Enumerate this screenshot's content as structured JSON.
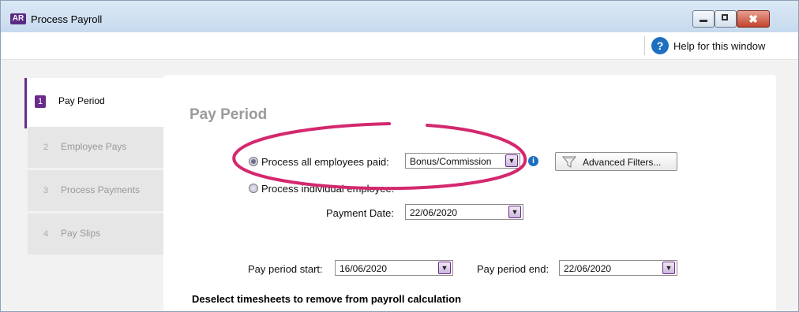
{
  "window": {
    "app_badge": "AR",
    "title": "Process Payroll",
    "controls": {
      "minimize_icon": "minimize-icon",
      "maximize_icon": "maximize-icon",
      "close_glyph": "✖"
    }
  },
  "toolbar": {
    "help_icon": "?",
    "help_label": "Help for this window"
  },
  "steps": [
    {
      "number": "1",
      "label": "Pay Period",
      "active": true
    },
    {
      "number": "2",
      "label": "Employee Pays",
      "active": false
    },
    {
      "number": "3",
      "label": "Process Payments",
      "active": false
    },
    {
      "number": "4",
      "label": "Pay Slips",
      "active": false
    }
  ],
  "panel": {
    "title": "Pay Period",
    "process_all_label": "Process all employees paid:",
    "pay_type": "Bonus/Commission",
    "info_icon": "i",
    "advanced_filters_label": "Advanced Filters...",
    "process_individual_label": "Process individual employee:",
    "payment_date_label": "Payment Date:",
    "payment_date": "22/06/2020",
    "pay_period_start_label": "Pay period start:",
    "pay_period_start": "16/06/2020",
    "pay_period_end_label": "Pay period end:",
    "pay_period_end": "22/06/2020",
    "deselect_note": "Deselect timesheets to remove from payroll calculation"
  },
  "colors": {
    "accent": "#6a2c8c",
    "highlight": "#d4286e",
    "help_blue": "#1d6fc0"
  }
}
